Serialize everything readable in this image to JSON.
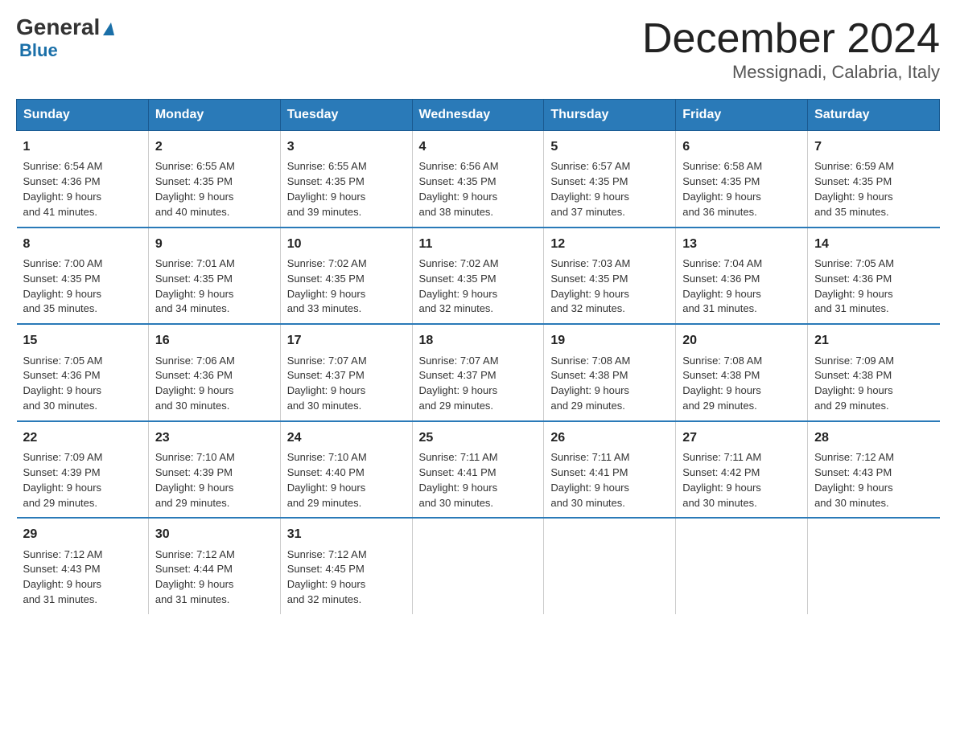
{
  "logo": {
    "line1a": "General",
    "line1b": "Blue"
  },
  "header": {
    "title": "December 2024",
    "subtitle": "Messignadi, Calabria, Italy"
  },
  "days_of_week": [
    "Sunday",
    "Monday",
    "Tuesday",
    "Wednesday",
    "Thursday",
    "Friday",
    "Saturday"
  ],
  "weeks": [
    [
      {
        "day": "1",
        "sunrise": "6:54 AM",
        "sunset": "4:36 PM",
        "daylight": "9 hours and 41 minutes."
      },
      {
        "day": "2",
        "sunrise": "6:55 AM",
        "sunset": "4:35 PM",
        "daylight": "9 hours and 40 minutes."
      },
      {
        "day": "3",
        "sunrise": "6:55 AM",
        "sunset": "4:35 PM",
        "daylight": "9 hours and 39 minutes."
      },
      {
        "day": "4",
        "sunrise": "6:56 AM",
        "sunset": "4:35 PM",
        "daylight": "9 hours and 38 minutes."
      },
      {
        "day": "5",
        "sunrise": "6:57 AM",
        "sunset": "4:35 PM",
        "daylight": "9 hours and 37 minutes."
      },
      {
        "day": "6",
        "sunrise": "6:58 AM",
        "sunset": "4:35 PM",
        "daylight": "9 hours and 36 minutes."
      },
      {
        "day": "7",
        "sunrise": "6:59 AM",
        "sunset": "4:35 PM",
        "daylight": "9 hours and 35 minutes."
      }
    ],
    [
      {
        "day": "8",
        "sunrise": "7:00 AM",
        "sunset": "4:35 PM",
        "daylight": "9 hours and 35 minutes."
      },
      {
        "day": "9",
        "sunrise": "7:01 AM",
        "sunset": "4:35 PM",
        "daylight": "9 hours and 34 minutes."
      },
      {
        "day": "10",
        "sunrise": "7:02 AM",
        "sunset": "4:35 PM",
        "daylight": "9 hours and 33 minutes."
      },
      {
        "day": "11",
        "sunrise": "7:02 AM",
        "sunset": "4:35 PM",
        "daylight": "9 hours and 32 minutes."
      },
      {
        "day": "12",
        "sunrise": "7:03 AM",
        "sunset": "4:35 PM",
        "daylight": "9 hours and 32 minutes."
      },
      {
        "day": "13",
        "sunrise": "7:04 AM",
        "sunset": "4:36 PM",
        "daylight": "9 hours and 31 minutes."
      },
      {
        "day": "14",
        "sunrise": "7:05 AM",
        "sunset": "4:36 PM",
        "daylight": "9 hours and 31 minutes."
      }
    ],
    [
      {
        "day": "15",
        "sunrise": "7:05 AM",
        "sunset": "4:36 PM",
        "daylight": "9 hours and 30 minutes."
      },
      {
        "day": "16",
        "sunrise": "7:06 AM",
        "sunset": "4:36 PM",
        "daylight": "9 hours and 30 minutes."
      },
      {
        "day": "17",
        "sunrise": "7:07 AM",
        "sunset": "4:37 PM",
        "daylight": "9 hours and 30 minutes."
      },
      {
        "day": "18",
        "sunrise": "7:07 AM",
        "sunset": "4:37 PM",
        "daylight": "9 hours and 29 minutes."
      },
      {
        "day": "19",
        "sunrise": "7:08 AM",
        "sunset": "4:38 PM",
        "daylight": "9 hours and 29 minutes."
      },
      {
        "day": "20",
        "sunrise": "7:08 AM",
        "sunset": "4:38 PM",
        "daylight": "9 hours and 29 minutes."
      },
      {
        "day": "21",
        "sunrise": "7:09 AM",
        "sunset": "4:38 PM",
        "daylight": "9 hours and 29 minutes."
      }
    ],
    [
      {
        "day": "22",
        "sunrise": "7:09 AM",
        "sunset": "4:39 PM",
        "daylight": "9 hours and 29 minutes."
      },
      {
        "day": "23",
        "sunrise": "7:10 AM",
        "sunset": "4:39 PM",
        "daylight": "9 hours and 29 minutes."
      },
      {
        "day": "24",
        "sunrise": "7:10 AM",
        "sunset": "4:40 PM",
        "daylight": "9 hours and 29 minutes."
      },
      {
        "day": "25",
        "sunrise": "7:11 AM",
        "sunset": "4:41 PM",
        "daylight": "9 hours and 30 minutes."
      },
      {
        "day": "26",
        "sunrise": "7:11 AM",
        "sunset": "4:41 PM",
        "daylight": "9 hours and 30 minutes."
      },
      {
        "day": "27",
        "sunrise": "7:11 AM",
        "sunset": "4:42 PM",
        "daylight": "9 hours and 30 minutes."
      },
      {
        "day": "28",
        "sunrise": "7:12 AM",
        "sunset": "4:43 PM",
        "daylight": "9 hours and 30 minutes."
      }
    ],
    [
      {
        "day": "29",
        "sunrise": "7:12 AM",
        "sunset": "4:43 PM",
        "daylight": "9 hours and 31 minutes."
      },
      {
        "day": "30",
        "sunrise": "7:12 AM",
        "sunset": "4:44 PM",
        "daylight": "9 hours and 31 minutes."
      },
      {
        "day": "31",
        "sunrise": "7:12 AM",
        "sunset": "4:45 PM",
        "daylight": "9 hours and 32 minutes."
      },
      {
        "day": "",
        "sunrise": "",
        "sunset": "",
        "daylight": ""
      },
      {
        "day": "",
        "sunrise": "",
        "sunset": "",
        "daylight": ""
      },
      {
        "day": "",
        "sunrise": "",
        "sunset": "",
        "daylight": ""
      },
      {
        "day": "",
        "sunrise": "",
        "sunset": "",
        "daylight": ""
      }
    ]
  ],
  "labels": {
    "sunrise": "Sunrise:",
    "sunset": "Sunset:",
    "daylight": "Daylight:"
  }
}
